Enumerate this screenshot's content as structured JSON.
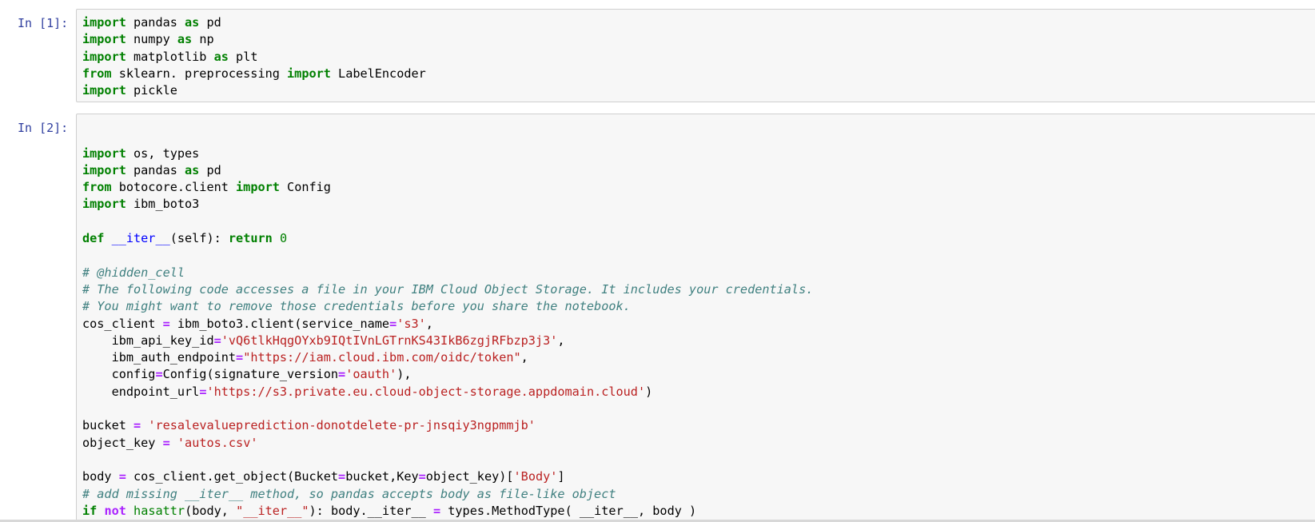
{
  "cells": [
    {
      "prompt": "In [1]:",
      "lines": [
        [
          {
            "t": "import",
            "c": "kw"
          },
          {
            "t": " pandas "
          },
          {
            "t": "as",
            "c": "kw"
          },
          {
            "t": " pd"
          }
        ],
        [
          {
            "t": "import",
            "c": "kw"
          },
          {
            "t": " numpy "
          },
          {
            "t": "as",
            "c": "kw"
          },
          {
            "t": " np"
          }
        ],
        [
          {
            "t": "import",
            "c": "kw"
          },
          {
            "t": " matplotlib "
          },
          {
            "t": "as",
            "c": "kw"
          },
          {
            "t": " plt"
          }
        ],
        [
          {
            "t": "from",
            "c": "kw"
          },
          {
            "t": " sklearn. preprocessing "
          },
          {
            "t": "import",
            "c": "kw"
          },
          {
            "t": " LabelEncoder"
          }
        ],
        [
          {
            "t": "import",
            "c": "kw"
          },
          {
            "t": " pickle"
          }
        ]
      ]
    },
    {
      "prompt": "In [2]:",
      "lines": [
        [],
        [],
        [
          {
            "t": "import",
            "c": "kw"
          },
          {
            "t": " os, types"
          }
        ],
        [
          {
            "t": "import",
            "c": "kw"
          },
          {
            "t": " pandas "
          },
          {
            "t": "as",
            "c": "kw"
          },
          {
            "t": " pd"
          }
        ],
        [
          {
            "t": "from",
            "c": "kw"
          },
          {
            "t": " botocore.client "
          },
          {
            "t": "import",
            "c": "kw"
          },
          {
            "t": " Config"
          }
        ],
        [
          {
            "t": "import",
            "c": "kw"
          },
          {
            "t": " ibm_boto3"
          }
        ],
        [],
        [
          {
            "t": "def",
            "c": "kw"
          },
          {
            "t": " "
          },
          {
            "t": "__iter__",
            "c": "nm"
          },
          {
            "t": "(self): "
          },
          {
            "t": "return",
            "c": "kw"
          },
          {
            "t": " "
          },
          {
            "t": "0",
            "c": "num"
          }
        ],
        [],
        [
          {
            "t": "# @hidden_cell",
            "c": "cm"
          }
        ],
        [
          {
            "t": "# The following code accesses a file in your IBM Cloud Object Storage. It includes your credentials.",
            "c": "cm"
          }
        ],
        [
          {
            "t": "# You might want to remove those credentials before you share the notebook.",
            "c": "cm"
          }
        ],
        [
          {
            "t": "cos_client "
          },
          {
            "t": "=",
            "c": "op"
          },
          {
            "t": " ibm_boto3.client(service_name"
          },
          {
            "t": "=",
            "c": "op"
          },
          {
            "t": "'s3'",
            "c": "str"
          },
          {
            "t": ","
          }
        ],
        [
          {
            "t": "    ibm_api_key_id"
          },
          {
            "t": "=",
            "c": "op"
          },
          {
            "t": "'vQ6tlkHqgOYxb9IQtIVnLGTrnKS43IkB6zgjRFbzp3j3'",
            "c": "str"
          },
          {
            "t": ","
          }
        ],
        [
          {
            "t": "    ibm_auth_endpoint"
          },
          {
            "t": "=",
            "c": "op"
          },
          {
            "t": "\"https://iam.cloud.ibm.com/oidc/token\"",
            "c": "str"
          },
          {
            "t": ","
          }
        ],
        [
          {
            "t": "    config"
          },
          {
            "t": "=",
            "c": "op"
          },
          {
            "t": "Config(signature_version"
          },
          {
            "t": "=",
            "c": "op"
          },
          {
            "t": "'oauth'",
            "c": "str"
          },
          {
            "t": "),"
          }
        ],
        [
          {
            "t": "    endpoint_url"
          },
          {
            "t": "=",
            "c": "op"
          },
          {
            "t": "'https://s3.private.eu.cloud-object-storage.appdomain.cloud'",
            "c": "str"
          },
          {
            "t": ")"
          }
        ],
        [],
        [
          {
            "t": "bucket "
          },
          {
            "t": "=",
            "c": "op"
          },
          {
            "t": " "
          },
          {
            "t": "'resalevalueprediction-donotdelete-pr-jnsqiy3ngpmmjb'",
            "c": "str"
          }
        ],
        [
          {
            "t": "object_key "
          },
          {
            "t": "=",
            "c": "op"
          },
          {
            "t": " "
          },
          {
            "t": "'autos.csv'",
            "c": "str"
          }
        ],
        [],
        [
          {
            "t": "body "
          },
          {
            "t": "=",
            "c": "op"
          },
          {
            "t": " cos_client.get_object(Bucket"
          },
          {
            "t": "=",
            "c": "op"
          },
          {
            "t": "bucket,Key"
          },
          {
            "t": "=",
            "c": "op"
          },
          {
            "t": "object_key)["
          },
          {
            "t": "'Body'",
            "c": "str"
          },
          {
            "t": "]"
          }
        ],
        [
          {
            "t": "# add missing __iter__ method, so pandas accepts body as file-like object",
            "c": "cm"
          }
        ],
        [
          {
            "t": "if",
            "c": "kw"
          },
          {
            "t": " "
          },
          {
            "t": "not",
            "c": "op"
          },
          {
            "t": " "
          },
          {
            "t": "hasattr",
            "c": "bi"
          },
          {
            "t": "(body, "
          },
          {
            "t": "\"__iter__\"",
            "c": "str"
          },
          {
            "t": "): body.__iter__ "
          },
          {
            "t": "=",
            "c": "op"
          },
          {
            "t": " types.MethodType( __iter__, body )"
          }
        ]
      ]
    }
  ]
}
